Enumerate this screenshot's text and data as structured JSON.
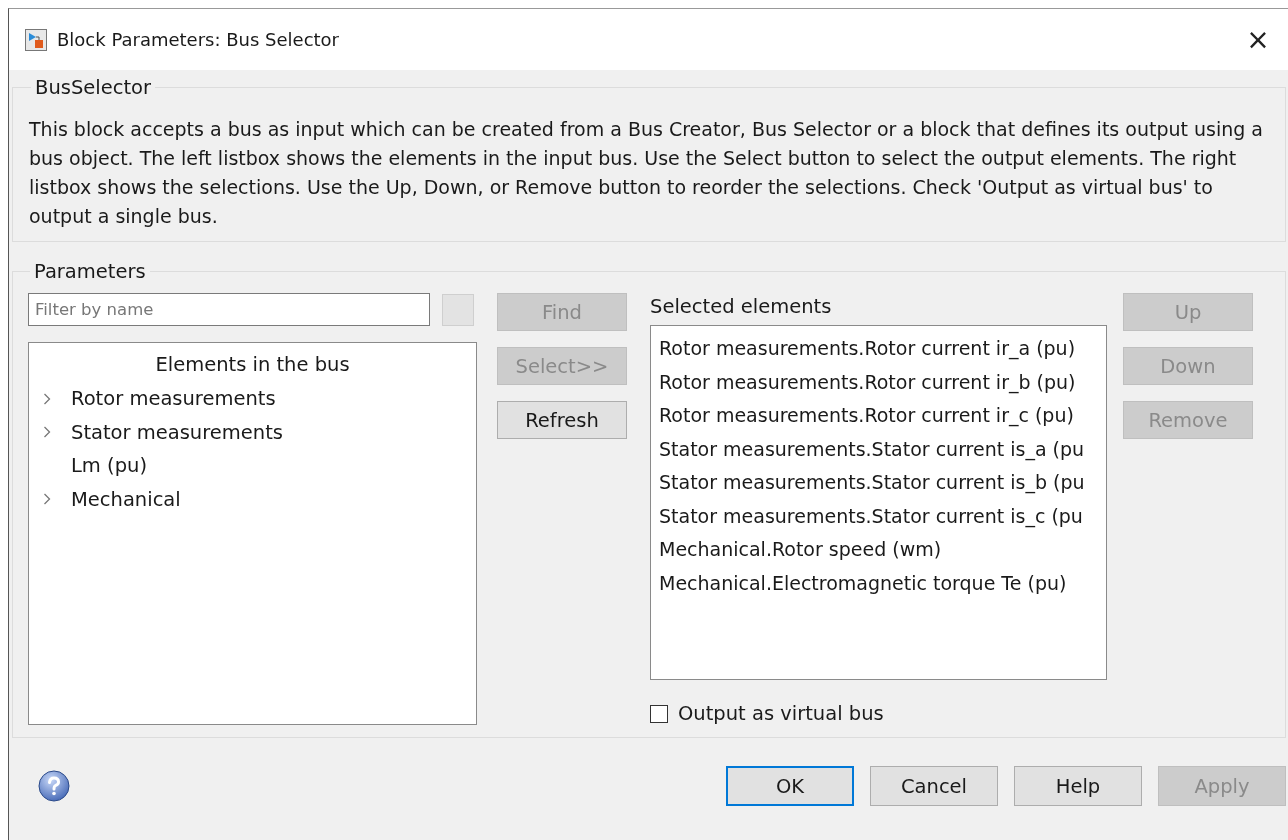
{
  "window": {
    "title": "Block Parameters: Bus Selector",
    "close": "×"
  },
  "description_group": {
    "legend": "BusSelector",
    "text": "This block accepts a bus as input which can be created from a Bus Creator, Bus Selector or a block that defines its output using a bus object. The left listbox shows the elements in the input bus. Use the Select button to select the output elements. The right listbox shows the selections. Use the Up, Down, or Remove button to reorder the selections. Check 'Output as virtual bus' to output a single bus."
  },
  "parameters": {
    "legend": "Parameters",
    "filter": {
      "placeholder": "Filter by name"
    },
    "tree": {
      "heading": "Elements in the bus",
      "items": [
        {
          "label": "Rotor measurements",
          "expandable": true
        },
        {
          "label": "Stator measurements",
          "expandable": true
        },
        {
          "label": "Lm (pu)",
          "expandable": false
        },
        {
          "label": "Mechanical",
          "expandable": true
        }
      ]
    },
    "middle_buttons": [
      {
        "label": "Find",
        "disabled": true
      },
      {
        "label": "Select>>",
        "disabled": true
      },
      {
        "label": "Refresh",
        "disabled": false
      }
    ],
    "selected_label": "Selected elements",
    "selected_items": [
      "Rotor measurements.Rotor current ir_a (pu)",
      "Rotor measurements.Rotor current ir_b (pu)",
      "Rotor measurements.Rotor current ir_c (pu)",
      "Stator measurements.Stator current is_a (pu",
      "Stator measurements.Stator current is_b (pu",
      "Stator measurements.Stator current is_c (pu",
      "Mechanical.Rotor speed (wm)",
      "Mechanical.Electromagnetic torque Te (pu)"
    ],
    "right_buttons": [
      {
        "label": "Up",
        "disabled": true
      },
      {
        "label": "Down",
        "disabled": true
      },
      {
        "label": "Remove",
        "disabled": true
      }
    ],
    "virtual_bus": {
      "label": "Output as virtual bus",
      "checked": false
    }
  },
  "buttons": [
    {
      "label": "OK",
      "disabled": false,
      "focused": true
    },
    {
      "label": "Cancel",
      "disabled": false,
      "focused": false
    },
    {
      "label": "Help",
      "disabled": false,
      "focused": false
    },
    {
      "label": "Apply",
      "disabled": true,
      "focused": false
    }
  ]
}
